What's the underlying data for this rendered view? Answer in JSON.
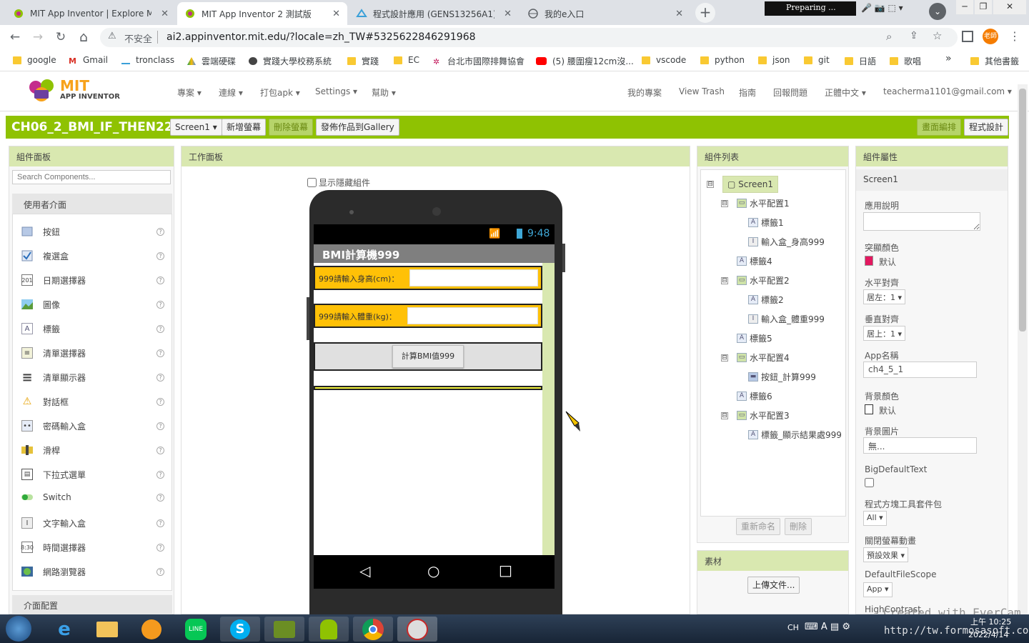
{
  "browser": {
    "tabs": [
      {
        "title": "MIT App Inventor | Explore MIT",
        "close": "✕"
      },
      {
        "title": "MIT App Inventor 2 測試版",
        "close": "✕"
      },
      {
        "title": "程式設計應用 (GENS13256A1)",
        "close": "✕"
      },
      {
        "title": "我的e入口",
        "close": "✕"
      }
    ],
    "new_tab": "+",
    "preparing": "Preparing ...",
    "window_controls": {
      "minimize": "─",
      "restore": "❐",
      "close": "✕"
    },
    "nav": {
      "back": "←",
      "forward": "→",
      "reload": "↻",
      "home": "⌂"
    },
    "security_label": "不安全",
    "url": "ai2.appinventor.mit.edu/?locale=zh_TW#5325622846291968",
    "profile": "老師",
    "bookmarks": [
      "google",
      "Gmail",
      "tronclass",
      "雲端硬碟",
      "實踐大學校務系統",
      "實踐",
      "EC",
      "台北市國際排舞協會",
      "(5) 腰圍瘦12cm沒...",
      "vscode",
      "python",
      "json",
      "git",
      "日語",
      "歌唱"
    ],
    "bookmarks_more": "»",
    "other_bookmarks": "其他書籤"
  },
  "appinventor": {
    "logo_mit": "MIT",
    "logo_sub": "APP INVENTOR",
    "menu_left": [
      "專案",
      "連線",
      "打包apk",
      "Settings",
      "幫助"
    ],
    "menu_right": [
      "我的專案",
      "View Trash",
      "指南",
      "回報問題"
    ],
    "language": "正體中文",
    "account": "teacherma1101@gmail.com",
    "project_name": "CH06_2_BMI_IF_THEN222",
    "screen_select": "Screen1",
    "add_screen": "新增螢幕",
    "remove_screen": "刪除螢幕",
    "publish_gallery": "發佈作品到Gallery",
    "designer_btn": "畫面編排",
    "blocks_btn": "程式設計"
  },
  "palette": {
    "title": "組件面板",
    "search_placeholder": "Search Components...",
    "category": "使用者介面",
    "items": [
      "按鈕",
      "複選盒",
      "日期選擇器",
      "圖像",
      "標籤",
      "清單選擇器",
      "清單顯示器",
      "對話框",
      "密碼輸入盒",
      "滑桿",
      "下拉式選單",
      "Switch",
      "文字輸入盒",
      "時間選擇器",
      "網路瀏覽器"
    ],
    "help": "?",
    "next_category": "介面配置"
  },
  "viewer": {
    "title": "工作面板",
    "show_hidden": "显示隱藏組件",
    "time": "9:48",
    "app_title": "BMI計算機999",
    "height_label": "999請輸入身高(cm)：",
    "weight_label": "999請輸入體重(kg)：",
    "button_label": "計算BMI值999",
    "nav_back": "◁",
    "nav_home": "○",
    "nav_recent": "□"
  },
  "components": {
    "title": "組件列表",
    "tree": [
      {
        "label": "Screen1",
        "icon": "",
        "toggle": "⊟"
      },
      {
        "label": "水平配置1",
        "icon": "▭",
        "toggle": "⊟"
      },
      {
        "label": "標籤1",
        "icon": "A",
        "toggle": ""
      },
      {
        "label": "輸入盒_身高999",
        "icon": "I",
        "toggle": ""
      },
      {
        "label": "標籤4",
        "icon": "A",
        "toggle": ""
      },
      {
        "label": "水平配置2",
        "icon": "▭",
        "toggle": "⊟"
      },
      {
        "label": "標籤2",
        "icon": "A",
        "toggle": ""
      },
      {
        "label": "輸入盒_體重999",
        "icon": "I",
        "toggle": ""
      },
      {
        "label": "標籤5",
        "icon": "A",
        "toggle": ""
      },
      {
        "label": "水平配置4",
        "icon": "▭",
        "toggle": "⊟"
      },
      {
        "label": "按鈕_計算999",
        "icon": "▬",
        "toggle": ""
      },
      {
        "label": "標籤6",
        "icon": "A",
        "toggle": ""
      },
      {
        "label": "水平配置3",
        "icon": "▭",
        "toggle": "⊟"
      },
      {
        "label": "標籤_顯示結果處999",
        "icon": "A",
        "toggle": ""
      }
    ],
    "rename": "重新命名",
    "delete": "刪除",
    "media_title": "素材",
    "upload": "上傳文件..."
  },
  "properties": {
    "title": "組件屬性",
    "component": "Screen1",
    "about_label": "應用說明",
    "accent_label": "突顯顏色",
    "accent_value": "默认",
    "align_h_label": "水平對齊",
    "align_h_value": "居左：1",
    "align_v_label": "垂直對齊",
    "align_v_value": "居上：1",
    "appname_label": "App名稱",
    "appname_value": "ch4_5_1",
    "bg_color_label": "背景顏色",
    "bg_color_value": "默认",
    "bg_image_label": "背景圖片",
    "bg_image_value": "無...",
    "big_text_label": "BigDefaultText",
    "blocks_toolkit_label": "程式方塊工具套件包",
    "blocks_toolkit_value": "All",
    "close_anim_label": "關閉螢幕動畫",
    "close_anim_value": "預設效果",
    "file_scope_label": "DefaultFileScope",
    "file_scope_value": "App",
    "next_label": "HighContrast"
  },
  "overlay": {
    "watermark1": "Created with EverCam",
    "watermark2": "http://tw.formosasoft.com"
  },
  "taskbar": {
    "lang": "CH",
    "time": "上午 10:25",
    "date": "2022/4/14"
  },
  "colors": {
    "green_bar": "#8fc202",
    "panel_head": "#d9e8b0",
    "phone_label": "#ffc107",
    "title_bar": "#7f7f7f"
  }
}
